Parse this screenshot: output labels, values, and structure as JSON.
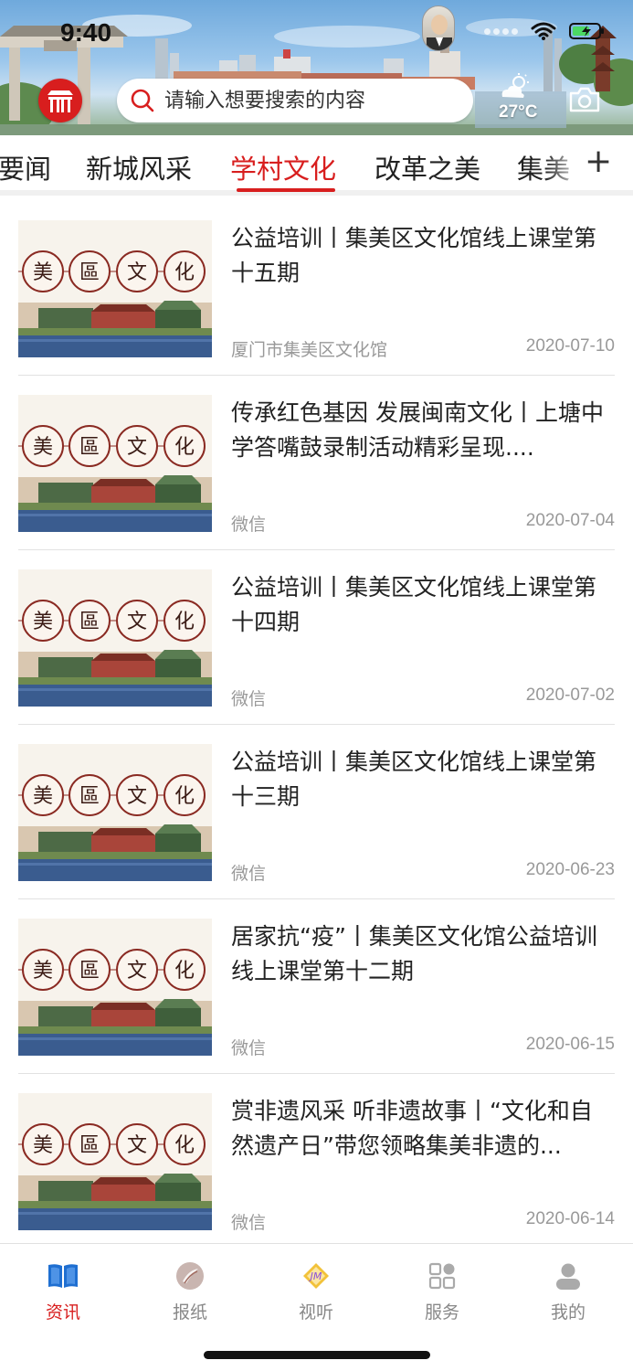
{
  "status_bar": {
    "time": "9:40"
  },
  "header": {
    "search_placeholder": "请输入想要搜索的内容",
    "weather_temp": "27°C",
    "accent_color": "#d81e1e"
  },
  "tabs": {
    "items": [
      {
        "label": "要闻",
        "active": false
      },
      {
        "label": "新城风采",
        "active": false
      },
      {
        "label": "学村文化",
        "active": true
      },
      {
        "label": "改革之美",
        "active": false
      },
      {
        "label": "集美",
        "active": false
      }
    ],
    "add_icon": "plus-icon"
  },
  "news": [
    {
      "title": "公益培训丨集美区文化馆线上课堂第十五期",
      "source": "厦门市集美区文化馆",
      "date": "2020-07-10"
    },
    {
      "title": "传承红色基因  发展闽南文化丨上塘中学答嘴鼓录制活动精彩呈现....",
      "source": "微信",
      "date": "2020-07-04"
    },
    {
      "title": "公益培训丨集美区文化馆线上课堂第十四期",
      "source": "微信",
      "date": "2020-07-02"
    },
    {
      "title": "公益培训丨集美区文化馆线上课堂第十三期",
      "source": "微信",
      "date": "2020-06-23"
    },
    {
      "title": "居家抗“疫”丨集美区文化馆公益培训线上课堂第十二期",
      "source": "微信",
      "date": "2020-06-15"
    },
    {
      "title": "赏非遗风采  听非遗故事丨“文化和自然遗产日”带您领略集美非遗的...",
      "source": "微信",
      "date": "2020-06-14"
    }
  ],
  "thumb_chars": [
    "美",
    "區",
    "文",
    "化"
  ],
  "bottom_nav": {
    "items": [
      {
        "label": "资讯",
        "icon": "book-icon",
        "active": true
      },
      {
        "label": "报纸",
        "icon": "newspaper-icon",
        "active": false
      },
      {
        "label": "视听",
        "icon": "media-icon",
        "active": false
      },
      {
        "label": "服务",
        "icon": "grid-icon",
        "active": false
      },
      {
        "label": "我的",
        "icon": "user-icon",
        "active": false
      }
    ]
  }
}
